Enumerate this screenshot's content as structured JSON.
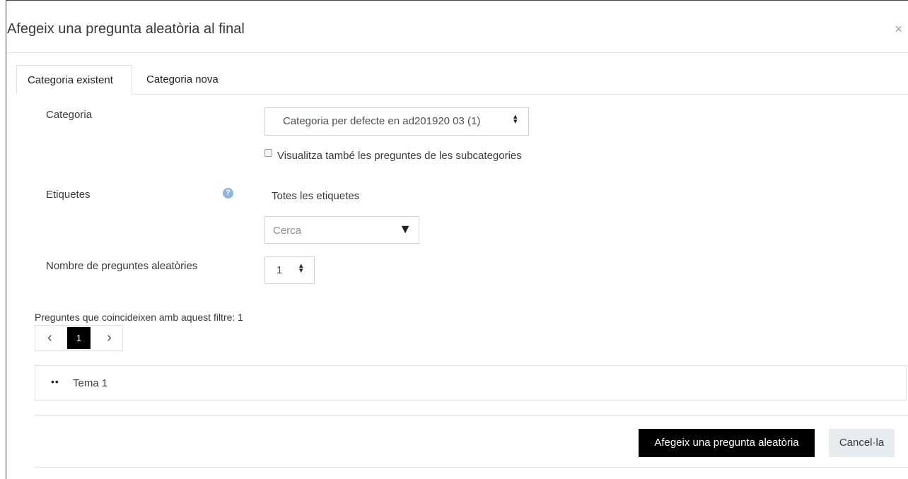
{
  "dialog": {
    "title": "Afegeix una pregunta aleatòria al final",
    "close_symbol": "×"
  },
  "tabs": [
    {
      "label": "Categoria existent",
      "active": true
    },
    {
      "label": "Categoria nova",
      "active": false
    }
  ],
  "form": {
    "category_label": "Categoria",
    "category_value": "Categoria per defecte en ad201920 03 (1)",
    "subcategories_checkbox_label": "Visualitza també les preguntes de les subcategories",
    "subcategories_checked": false,
    "tags_label": "Etiquetes",
    "tags_value": "Totes les etiquetes",
    "tags_search_placeholder": "Cerca",
    "random_count_label": "Nombre de preguntes aleatòries",
    "random_count_value": "1"
  },
  "filter": {
    "match_text": "Preguntes que coincideixen amb aquest filtre: 1",
    "pagination": {
      "prev": "‹",
      "current": "1",
      "next": "›"
    },
    "items": [
      "Tema 1"
    ]
  },
  "buttons": {
    "add_random": "Afegeix una pregunta aleatòria",
    "cancel": "Cancel·la"
  },
  "icons": {
    "help": "question-circle-icon",
    "select_arrows": "sort-arrows-icon",
    "dropdown": "caret-down-icon",
    "bullet": "bullet-dots-icon"
  },
  "colors": {
    "primary_button": "#000000",
    "secondary_button": "#e9ecef",
    "help_icon": "#8fb3e5"
  }
}
